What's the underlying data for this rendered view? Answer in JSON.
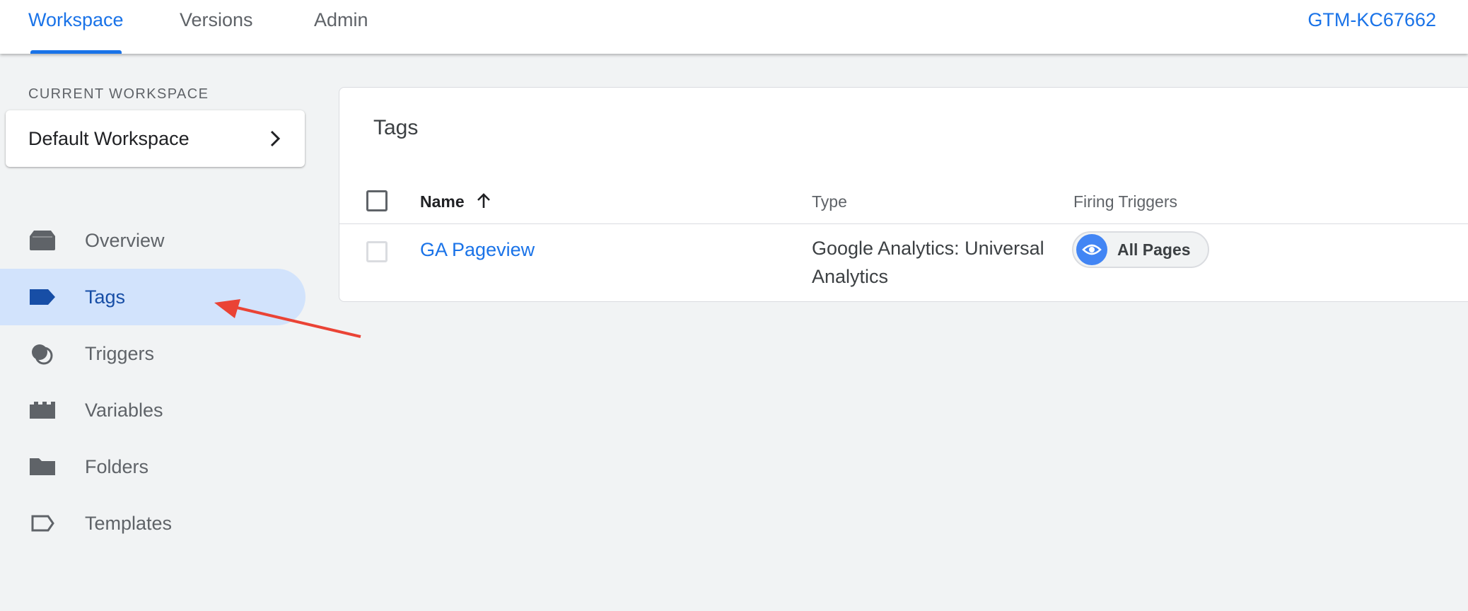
{
  "topnav": {
    "tabs": [
      {
        "label": "Workspace",
        "active": true
      },
      {
        "label": "Versions",
        "active": false
      },
      {
        "label": "Admin",
        "active": false
      }
    ],
    "container_id": "GTM-KC67662"
  },
  "sidebar": {
    "section_label": "CURRENT WORKSPACE",
    "workspace_name": "Default Workspace",
    "items": [
      {
        "label": "Overview",
        "icon": "overview-icon",
        "active": false
      },
      {
        "label": "Tags",
        "icon": "tag-icon",
        "active": true
      },
      {
        "label": "Triggers",
        "icon": "trigger-icon",
        "active": false
      },
      {
        "label": "Variables",
        "icon": "variables-icon",
        "active": false
      },
      {
        "label": "Folders",
        "icon": "folder-icon",
        "active": false
      },
      {
        "label": "Templates",
        "icon": "template-icon",
        "active": false
      }
    ]
  },
  "main": {
    "title": "Tags",
    "columns": {
      "name": "Name",
      "type": "Type",
      "triggers": "Firing Triggers"
    },
    "rows": [
      {
        "name": "GA Pageview",
        "type": "Google Analytics: Universal Analytics",
        "trigger": "All Pages"
      }
    ]
  },
  "colors": {
    "accent": "#1a73e8",
    "active_nav_bg": "#d2e3fc",
    "trigger_icon_bg": "#4285f4",
    "annotation_arrow": "#ea4335"
  }
}
